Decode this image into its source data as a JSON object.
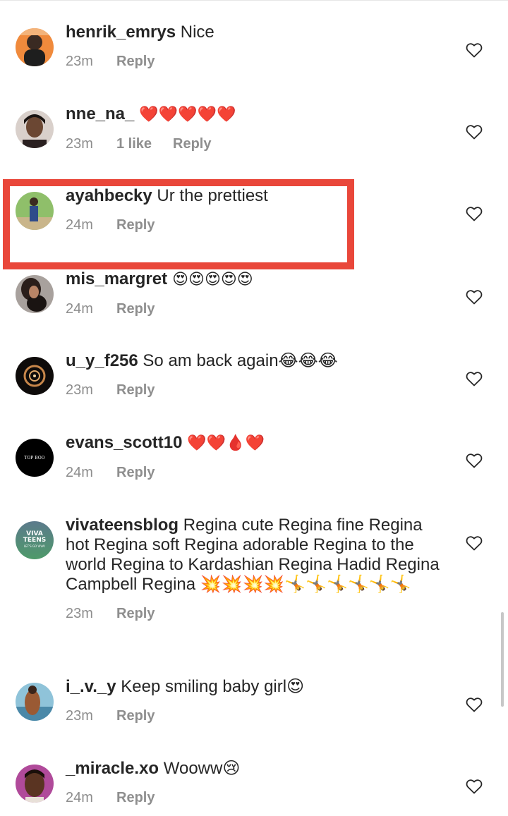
{
  "comments": [
    {
      "username": "henrik_emrys",
      "text": " Nice",
      "time": "23m",
      "likes": "",
      "reply": "Reply"
    },
    {
      "username": "nne_na_",
      "text": " ❤️❤️❤️❤️❤️",
      "time": "23m",
      "likes": "1 like",
      "reply": "Reply"
    },
    {
      "username": "ayahbecky",
      "text": " Ur the prettiest",
      "time": "24m",
      "likes": "",
      "reply": "Reply"
    },
    {
      "username": "mis_margret",
      "text": " 😍😍😍😍😍",
      "time": "24m",
      "likes": "",
      "reply": "Reply"
    },
    {
      "username": "u_y_f256",
      "text": " So am back again😂😂😂",
      "time": "23m",
      "likes": "",
      "reply": "Reply"
    },
    {
      "username": "evans_scott10",
      "text": " ❤️❤️🩸❤️",
      "time": "24m",
      "likes": "",
      "reply": "Reply"
    },
    {
      "username": "vivateensblog",
      "text": " Regina cute  Regina fine Regina hot Regina soft Regina adorable Regina to the world Regina to Kardashian Regina Hadid Regina Campbell Regina 💥💥💥💥🤸🤸🤸🤸🤸🤸",
      "time": "23m",
      "likes": "",
      "reply": "Reply"
    },
    {
      "username": "i_.v._y",
      "text": " Keep smiling baby girl😍",
      "time": "23m",
      "likes": "",
      "reply": "Reply"
    },
    {
      "username": "_miracle.xo",
      "text": " Wooww😢",
      "time": "24m",
      "likes": "",
      "reply": "Reply"
    }
  ],
  "avatars": {
    "evans_scott10_text": "TOP BOO",
    "vivateensblog_line1": "VIVA",
    "vivateensblog_line2": "TEENS",
    "vivateensblog_line3": "LET'S GO VIVA!"
  },
  "colors": {
    "highlight": "#e9473a",
    "meta": "#8e8e8e",
    "text": "#262626"
  },
  "icons": {
    "like": "heart-outline-icon"
  }
}
